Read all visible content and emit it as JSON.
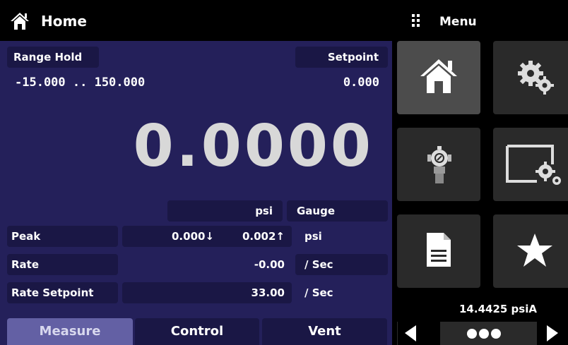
{
  "header": {
    "title": "Home",
    "menu_title": "Menu"
  },
  "main": {
    "range_hold_label": "Range Hold",
    "range_value": "-15.000 .. 150.000",
    "setpoint_label": "Setpoint",
    "setpoint_value": "0.000",
    "reading": "0.0000",
    "unit": "psi",
    "mode": "Gauge",
    "peak": {
      "label": "Peak",
      "min": "0.000↓",
      "max": "0.002↑",
      "unit": "psi"
    },
    "rate": {
      "label": "Rate",
      "value": "-0.00",
      "unit": "/ Sec"
    },
    "rate_setpoint": {
      "label": "Rate Setpoint",
      "value": "33.00",
      "unit": "/ Sec"
    }
  },
  "tabs": [
    {
      "label": "Measure",
      "active": true
    },
    {
      "label": "Control",
      "active": false
    },
    {
      "label": "Vent",
      "active": false
    }
  ],
  "menu": {
    "tiles": [
      {
        "icon": "home-icon",
        "active": true
      },
      {
        "icon": "settings-gears-icon",
        "active": false
      },
      {
        "icon": "controller-icon",
        "active": false
      },
      {
        "icon": "display-settings-icon",
        "active": false
      },
      {
        "icon": "document-icon",
        "active": false
      },
      {
        "icon": "star-icon",
        "active": false
      }
    ],
    "barometer": "14.4425 psiA"
  },
  "colors": {
    "main_panel": "#24205a",
    "chip": "#1a1745",
    "active_tab": "#6360a4",
    "tile": "#2a2a2a",
    "tile_active": "#4c4c4c"
  }
}
